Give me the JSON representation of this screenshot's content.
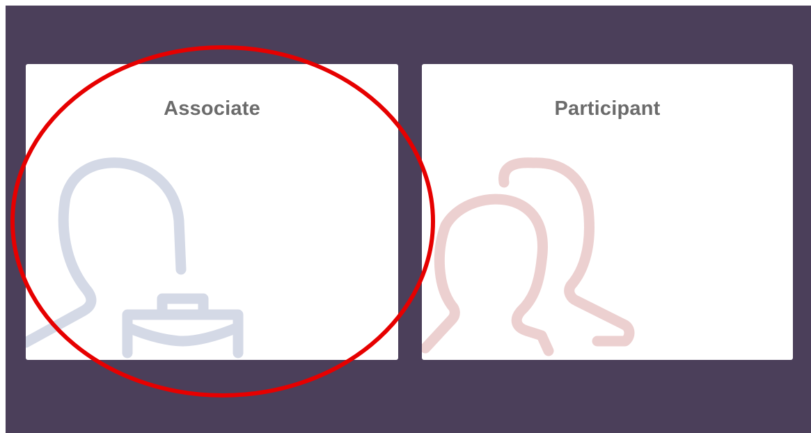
{
  "cards": {
    "associate": {
      "label": "Associate",
      "icon": "associate-briefcase-icon",
      "icon_color": "#d4d9e6"
    },
    "participant": {
      "label": "Participant",
      "icon": "participants-group-icon",
      "icon_color": "#ecd0d0"
    }
  },
  "colors": {
    "background": "#4b3f5a",
    "card": "#ffffff",
    "title": "#6b6b6b",
    "highlight_annotation": "#e60000"
  }
}
